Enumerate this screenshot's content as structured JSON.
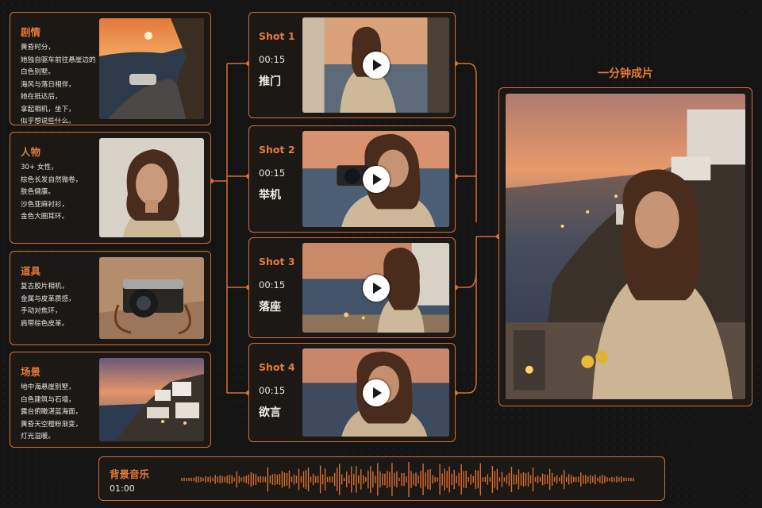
{
  "info_cards": [
    {
      "title": "剧情",
      "lines": [
        "黄昏时分，",
        "她独自驱车前往悬崖边的",
        "白色别墅。",
        "海风与落日相伴，",
        "她在抵达后，",
        "拿起相机，坐下，",
        "似乎想说些什么。"
      ]
    },
    {
      "title": "人物",
      "lines": [
        "30+ 女性，",
        "棕色长发自然微卷，",
        "肤色健康。",
        "沙色亚麻衬衫，",
        "金色大圈耳环。"
      ]
    },
    {
      "title": "道具",
      "lines": [
        "复古胶片相机，",
        "金属与皮革质感，",
        "手动对焦环，",
        "肩带棕色皮革。"
      ]
    },
    {
      "title": "场景",
      "lines": [
        "地中海悬崖别墅，",
        "白色建筑与石墙，",
        "露台俯瞰湛蓝海面，",
        "黄昏天空橙粉渐变，",
        "灯光温暖。"
      ]
    }
  ],
  "shots": [
    {
      "title": "Shot 1",
      "duration": "00:15",
      "name": "推门"
    },
    {
      "title": "Shot 2",
      "duration": "00:15",
      "name": "举机"
    },
    {
      "title": "Shot 3",
      "duration": "00:15",
      "name": "落座"
    },
    {
      "title": "Shot 4",
      "duration": "00:15",
      "name": "欲言"
    }
  ],
  "final": {
    "label": "一分钟成片"
  },
  "music": {
    "title": "背景音乐",
    "time": "01:00"
  },
  "colors": {
    "accent": "#d96f2e",
    "accent_text": "#e8793a",
    "background": "#141414"
  }
}
